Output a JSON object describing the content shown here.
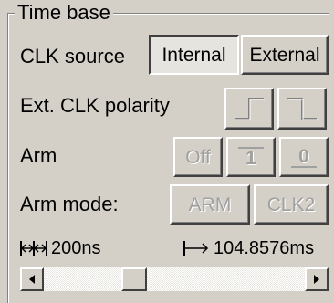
{
  "groupbox": {
    "title": "Time base"
  },
  "clk_source": {
    "label": "CLK source",
    "options": [
      {
        "label": "Internal",
        "selected": true
      },
      {
        "label": "External",
        "selected": false
      }
    ]
  },
  "ext_clk_polarity": {
    "label": "Ext. CLK polarity",
    "rising_icon": "rising-edge-icon",
    "falling_icon": "falling-edge-icon"
  },
  "arm": {
    "label": "Arm",
    "buttons": [
      "Off",
      "1",
      "0"
    ]
  },
  "arm_mode": {
    "label": "Arm mode:",
    "buttons": [
      "ARM",
      "CLK2"
    ]
  },
  "timing": {
    "sample_period": "200ns",
    "total_span": "104.8576ms",
    "sample_period_icon": "sample-period-icon",
    "total_span_icon": "span-arrow-icon"
  },
  "scrollbar": {
    "left_icon": "scroll-left-icon",
    "right_icon": "scroll-right-icon",
    "position_fraction": 0.33
  }
}
